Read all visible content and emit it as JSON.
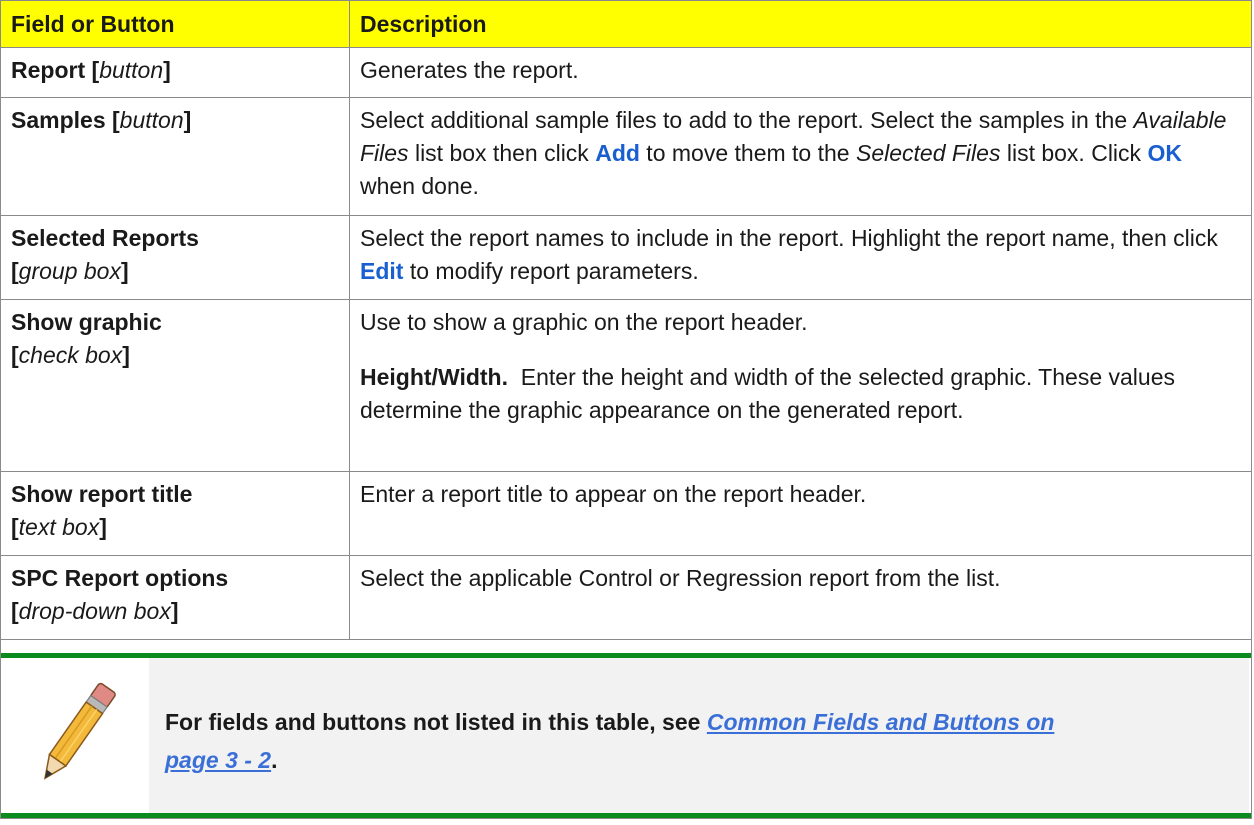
{
  "table": {
    "headers": [
      "Field or Button",
      "Description"
    ],
    "rows": [
      {
        "name": "Report",
        "type": "button",
        "desc": [
          "Generates the report."
        ]
      },
      {
        "name": "Samples",
        "type": "button",
        "desc": [
          "Select additional sample files to add to the report. Select the samples in the ",
          "Available Files",
          " list box then click ",
          "Add",
          " to move them to the ",
          "Selected Files",
          " list box. Click ",
          "OK",
          " when done."
        ]
      },
      {
        "name": "Selected Reports",
        "type": "group box",
        "desc": [
          "Select the report names to include in the report. Highlight the report name, then click ",
          "Edit",
          " to modify report parameters."
        ]
      },
      {
        "name": "Show graphic",
        "type": "check box",
        "desc": [
          "Use to show a graphic on the report header."
        ],
        "sub_label": "Height/Width.",
        "sub_desc": "Enter the height and width of the selected graphic. These values determine the graphic appearance on the generated report."
      },
      {
        "name": "Show report title",
        "type": "text box",
        "desc": [
          "Enter a report title to appear on the report header."
        ]
      },
      {
        "name": "SPC Report options",
        "type": "drop-down box",
        "desc": [
          "Select the applicable Control or Regression report from the list."
        ]
      }
    ]
  },
  "note": {
    "icon": "pencil-icon",
    "text": "For fields and buttons not listed in this table, see ",
    "link": "Common Fields and Buttons on page 3 - 2",
    "end": "."
  },
  "colors": {
    "header_bg": "#ffff00",
    "button_ref": "#1a5fd0",
    "note_bar": "#0b8a1e",
    "note_bg": "#f2f2f2",
    "link": "#3a6fd8"
  }
}
